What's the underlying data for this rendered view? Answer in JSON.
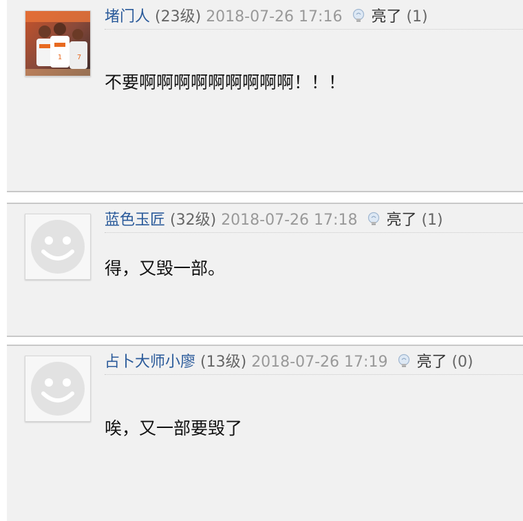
{
  "comments": [
    {
      "username": "堵门人",
      "level": "(23级)",
      "timestamp": "2018-07-26 17:16",
      "like_label": "亮了",
      "like_count": "(1)",
      "content": "不要啊啊啊啊啊啊啊啊啊！！！",
      "avatar_type": "photo"
    },
    {
      "username": "蓝色玉匠",
      "level": "(32级)",
      "timestamp": "2018-07-26 17:18",
      "like_label": "亮了",
      "like_count": "(1)",
      "content": "得，又毁一部。",
      "avatar_type": "default-smiley"
    },
    {
      "username": "占卜大师小廖",
      "level": "(13级)",
      "timestamp": "2018-07-26 17:19",
      "like_label": "亮了",
      "like_count": "(0)",
      "content": "唉，又一部要毁了",
      "avatar_type": "default-smiley"
    }
  ],
  "colors": {
    "username": "#2a5a9a",
    "background": "#f1f1f1",
    "timestamp": "#999999"
  }
}
